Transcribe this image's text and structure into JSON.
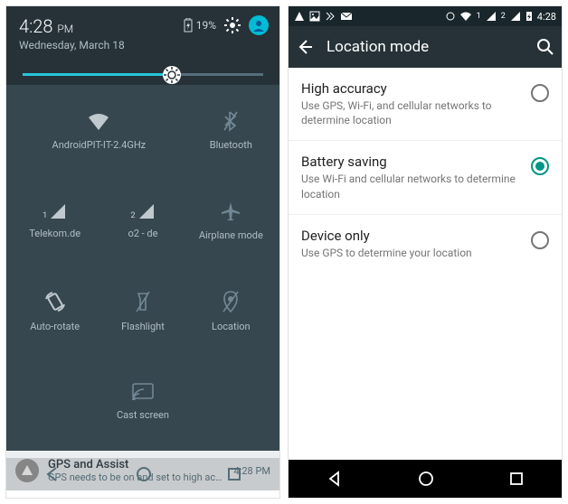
{
  "left": {
    "status": {
      "battery_pct": "19%"
    },
    "time": "4:28",
    "ampm": "PM",
    "date": "Wednesday, March 18",
    "brightness_pct": 62,
    "tiles": {
      "wifi": "AndroidPIT-IT-2.4GHz",
      "bluetooth": "Bluetooth",
      "sim1": "Telekom.de",
      "sim1_index": "1",
      "sim2": "o2 - de",
      "sim2_index": "2",
      "airplane": "Airplane mode",
      "autorotate": "Auto-rotate",
      "flashlight": "Flashlight",
      "location": "Location",
      "cast": "Cast screen"
    },
    "notification": {
      "title": "GPS and Assist",
      "subtitle": "GPS needs to be on and set to high accura..",
      "time": "4:28 PM"
    }
  },
  "right": {
    "status_time": "4:28",
    "sim_labels": {
      "one": "1",
      "two": "2"
    },
    "title": "Location mode",
    "options": [
      {
        "title": "High accuracy",
        "sub": "Use GPS, Wi-Fi, and cellular networks to determine location",
        "selected": false
      },
      {
        "title": "Battery saving",
        "sub": "Use Wi-Fi and cellular networks to determine location",
        "selected": true
      },
      {
        "title": "Device only",
        "sub": "Use GPS to determine your location",
        "selected": false
      }
    ]
  }
}
